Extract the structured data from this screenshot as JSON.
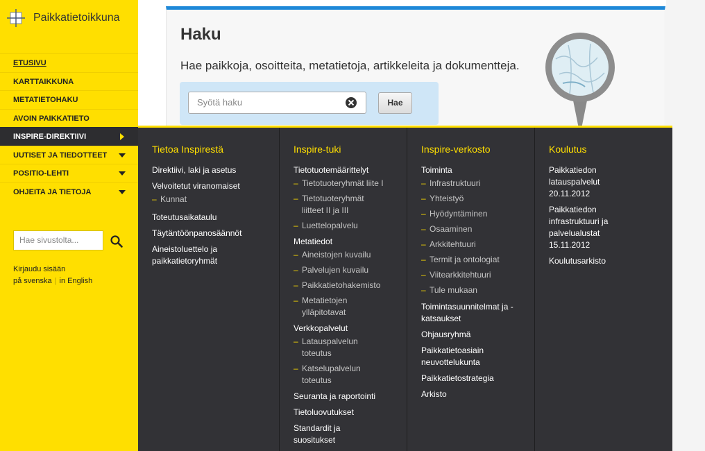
{
  "site": {
    "name": "Paikkatietoikkuna"
  },
  "nav": [
    {
      "label": "Etusivu"
    },
    {
      "label": "Karttaikkuna"
    },
    {
      "label": "Metatietohaku"
    },
    {
      "label": "Avoin paikkatieto"
    },
    {
      "label": "Inspire-direktiivi"
    },
    {
      "label": "Uutiset ja tiedotteet"
    },
    {
      "label": "Positio-lehti"
    },
    {
      "label": "Ohjeita ja tietoja"
    }
  ],
  "site_search": {
    "placeholder": "Hae sivustolta..."
  },
  "links": {
    "login": "Kirjaudu sisään",
    "swedish": "på svenska",
    "english": "in English"
  },
  "haku": {
    "title": "Haku",
    "description": "Hae paikkoja, osoitteita, metatietoja, artikkeleita ja dokumentteja.",
    "placeholder": "Syötä haku",
    "button": "Hae"
  },
  "mega": {
    "col1": {
      "heading": "Tietoa Inspirestä",
      "items": [
        "Direktiivi, laki ja asetus",
        "Velvoitetut viranomaiset",
        "Kunnat",
        "Toteutusaikataulu",
        "Täytäntöönpanosäännöt",
        "Aineistoluettelo ja paikkatietoryhmät"
      ]
    },
    "col2": {
      "heading": "Inspire-tuki",
      "items": [
        "Tietotuotemäärittelyt",
        "Tietotuoteryhmät liite I",
        "Tietotuoteryhmät liitteet II ja III",
        "Luettelopalvelu",
        "Metatiedot",
        "Aineistojen kuvailu",
        "Palvelujen kuvailu",
        "Paikkatietohakemisto",
        "Metatietojen ylläpitotavat",
        "Verkkopalvelut",
        "Latauspalvelun toteutus",
        "Katselupalvelun toteutus",
        "Seuranta ja raportointi",
        "Tietoluovutukset",
        "Standardit ja suositukset"
      ]
    },
    "col3": {
      "heading": "Inspire-verkosto",
      "items": [
        "Toiminta",
        "Infrastruktuuri",
        "Yhteistyö",
        "Hyödyntäminen",
        "Osaaminen",
        "Arkkitehtuuri",
        "Termit ja ontologiat",
        "Viitearkkitehtuuri",
        "Tule mukaan",
        "Toimintasuunnitelmat ja -katsaukset",
        "Ohjausryhmä",
        "Paikkatietoasiain neuvottelukunta",
        "Paikkatietostrategia",
        "Arkisto"
      ]
    },
    "col4": {
      "heading": "Koulutus",
      "items": [
        "Paikkatiedon latauspalvelut 20.11.2012",
        "Paikkatiedon infrastruktuuri ja palvelualustat 15.11.2012",
        "Koulutusarkisto"
      ]
    }
  },
  "colors": {
    "brand_yellow": "#ffdf00",
    "menu_dark": "#323236",
    "accent_blue": "#1e88d8"
  }
}
